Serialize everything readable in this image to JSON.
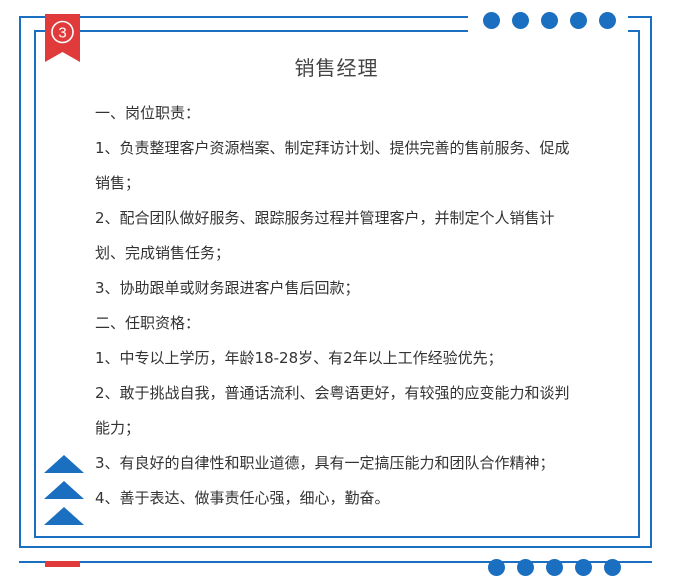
{
  "badge": {
    "number": "3"
  },
  "title": "销售经理",
  "lines": [
    "一、岗位职责：",
    "1、负责整理客户资源档案、制定拜访计划、提供完善的售前服务、促成",
    "销售；",
    "2、配合团队做好服务、跟踪服务过程并管理客户，并制定个人销售计",
    "划、完成销售任务；",
    "3、协助跟单或财务跟进客户售后回款；",
    "二、任职资格：",
    "1、中专以上学历，年龄18-28岁、有2年以上工作经验优先；",
    "2、敢于挑战自我，普通话流利、会粤语更好，有较强的应变能力和谈判",
    "能力；",
    "3、有良好的自律性和职业道德，具有一定搞压能力和团队合作精神；",
    "4、善于表达、做事责任心强，细心，勤奋。"
  ],
  "colors": {
    "accent": "#1a6fc0",
    "badge_red": "#e03a3a",
    "text": "#333333"
  },
  "icons": [
    "number-ribbon-badge",
    "decorative-dots",
    "up-arrow-chevrons"
  ]
}
